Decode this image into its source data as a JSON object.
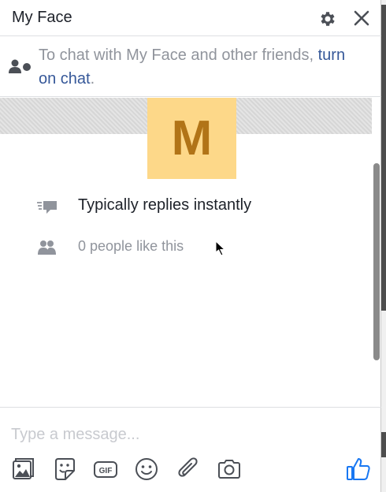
{
  "header": {
    "title": "My Face"
  },
  "notice": {
    "text_prefix": "To chat with My Face and other friends,",
    "link_label": "turn on chat",
    "text_suffix": "."
  },
  "profile": {
    "avatar_letter": "M",
    "response_time": "Typically replies instantly",
    "likes_text": "0 people like this"
  },
  "composer": {
    "placeholder": "Type a message..."
  },
  "icons": {
    "settings": "gear-icon",
    "close": "close-icon",
    "chat_off": "person-offline-icon",
    "response": "speech-bubble-icon",
    "likes": "people-icon",
    "photo": "photo-icon",
    "sticker": "sticker-icon",
    "gif": "gif-icon",
    "emoji": "emoji-icon",
    "attach": "paperclip-icon",
    "camera": "camera-icon",
    "like": "thumbs-up-icon"
  },
  "colors": {
    "link": "#365899",
    "like_button": "#1877f2",
    "avatar_bg": "#fdd889",
    "avatar_letter": "#b17417",
    "muted_text": "#90949c"
  }
}
